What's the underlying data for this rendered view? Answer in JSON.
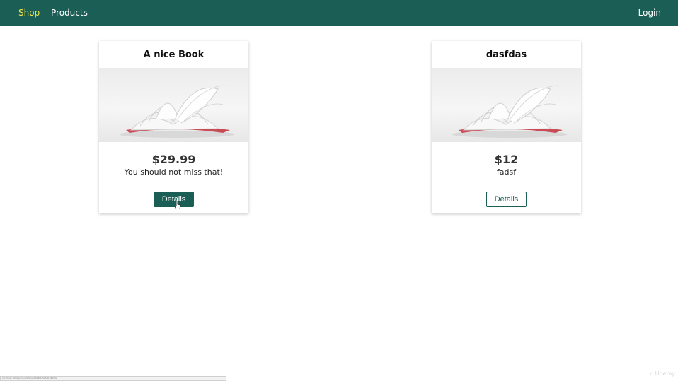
{
  "nav": {
    "shop": "Shop",
    "products": "Products",
    "login": "Login"
  },
  "products": [
    {
      "title": "A nice Book",
      "price": "$29.99",
      "description": "You should not miss that!",
      "details_label": "Details"
    },
    {
      "title": "dasfdas",
      "price": "$12",
      "description": "fadsf",
      "details_label": "Details"
    }
  ],
  "status_url": "localhost:3000/products/5baa5025f6c5e56b48d2fa",
  "watermark": "Udemy",
  "colors": {
    "header_bg": "#1b5e55",
    "active_nav": "#f2e94e",
    "button": "#1b5e55"
  }
}
